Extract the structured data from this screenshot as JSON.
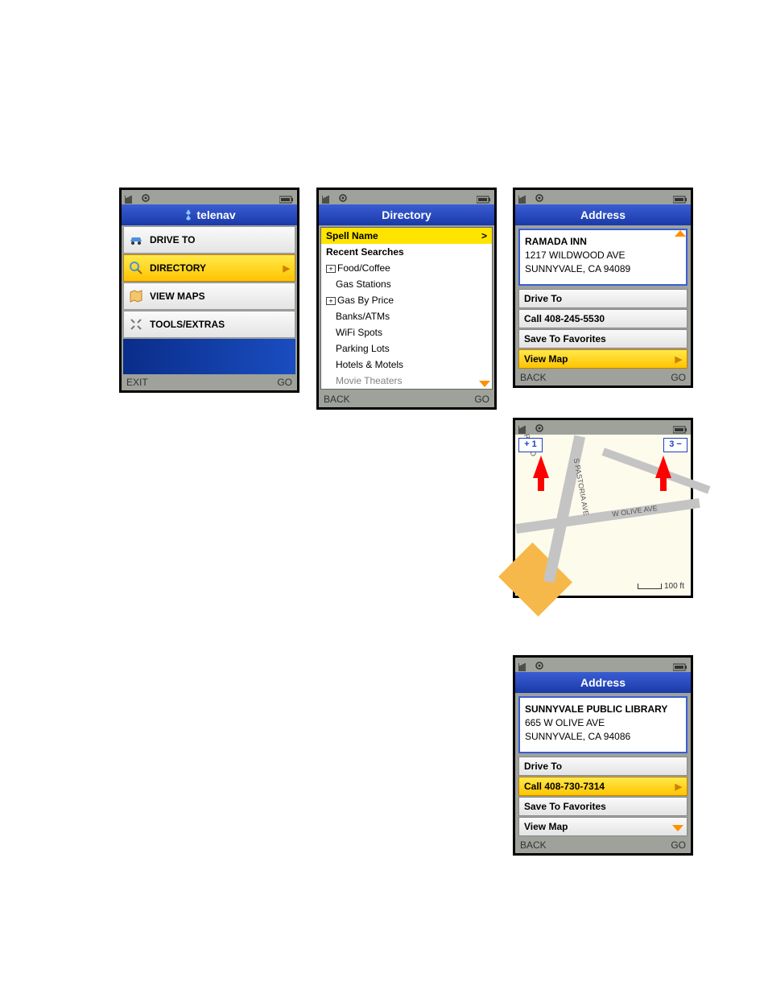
{
  "screen1": {
    "logo_text": "telenav",
    "items": [
      "DRIVE TO",
      "DIRECTORY",
      "VIEW MAPS",
      "TOOLS/EXTRAS"
    ],
    "soft_left": "EXIT",
    "soft_right": "GO"
  },
  "screen2": {
    "title": "Directory",
    "spell": "Spell Name",
    "spell_arrow": ">",
    "recent": "Recent Searches",
    "cats": [
      "Food/Coffee",
      "Gas Stations",
      "Gas By Price",
      "Banks/ATMs",
      "WiFi Spots",
      "Parking Lots",
      "Hotels & Motels",
      "Movie Theaters"
    ],
    "soft_left": "BACK",
    "soft_right": "GO"
  },
  "screen3": {
    "title": "Address",
    "name": "RAMADA INN",
    "line1": "1217 WILDWOOD AVE",
    "line2": "SUNNYVALE, CA 94089",
    "actions": [
      "Drive To",
      "Call 408-245-5530",
      "Save To Favorites",
      "View Map"
    ],
    "soft_left": "BACK",
    "soft_right": "GO"
  },
  "screen4": {
    "zoom_in": "+ 1",
    "zoom_out": "3 −",
    "streets": {
      "pastoria": "S PASTORIA AVE",
      "olive": "W OLIVE AVE",
      "rinco": "RINCO"
    },
    "scale": "100 ft"
  },
  "screen5": {
    "title": "Address",
    "name": "SUNNYVALE PUBLIC LIBRARY",
    "line1": "665 W OLIVE AVE",
    "line2": "SUNNYVALE, CA 94086",
    "actions": [
      "Drive To",
      "Call 408-730-7314",
      "Save To Favorites",
      "View Map"
    ],
    "soft_left": "BACK",
    "soft_right": "GO"
  }
}
